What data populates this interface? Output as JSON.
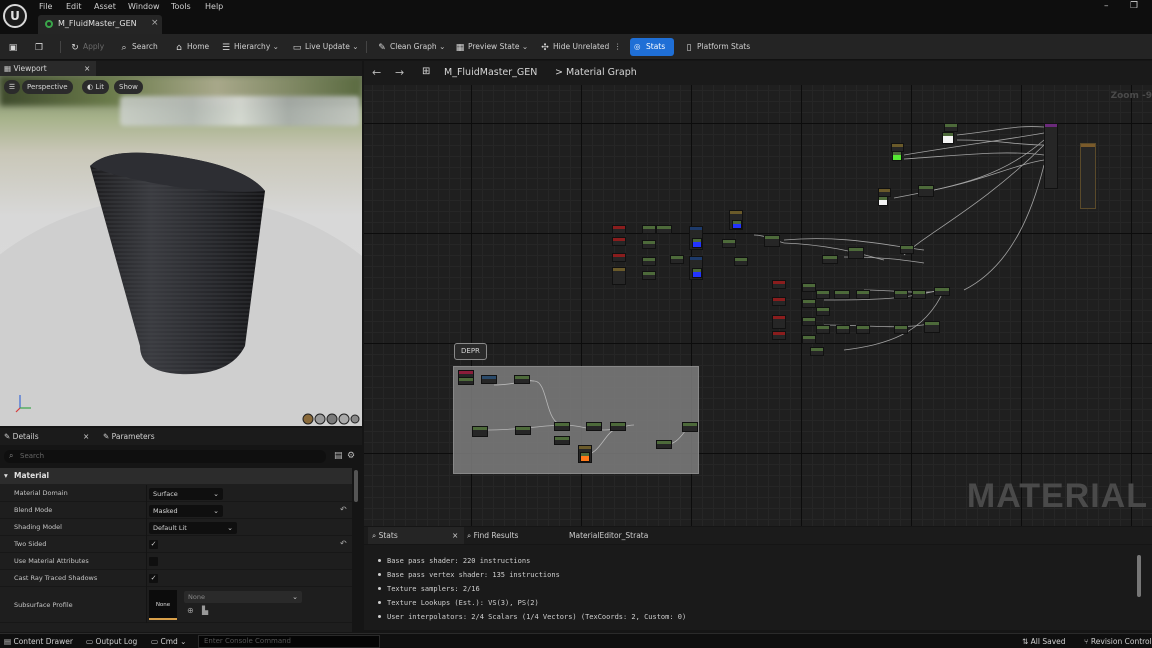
{
  "menu": [
    "File",
    "Edit",
    "Asset",
    "Window",
    "Tools",
    "Help"
  ],
  "logo_text": "U",
  "document_tab": {
    "label": "M_FluidMaster_GEN",
    "close": "×"
  },
  "window_controls": {
    "minimize": "–",
    "restore": "❐"
  },
  "toolbar": {
    "apply": "Apply",
    "search": "Search",
    "home": "Home",
    "hierarchy": "Hierarchy",
    "live_update": "Live Update",
    "clean_graph": "Clean Graph",
    "preview_state": "Preview State",
    "hide_unrelated": "Hide Unrelated",
    "stats": "Stats",
    "platform_stats": "Platform Stats"
  },
  "viewport": {
    "tab_label": "Viewport",
    "close": "×",
    "perspective": "Perspective",
    "lit": "Lit",
    "show": "Show"
  },
  "details": {
    "tab_details": "Details",
    "tab_parameters": "Parameters",
    "close": "×",
    "search_placeholder": "Search",
    "category": "Material",
    "rows": [
      {
        "label": "Material Domain",
        "value": "Surface"
      },
      {
        "label": "Blend Mode",
        "value": "Masked"
      },
      {
        "label": "Shading Model",
        "value": "Default Lit"
      },
      {
        "label": "Two Sided",
        "checked": true
      },
      {
        "label": "Use Material Attributes",
        "checked": false
      },
      {
        "label": "Cast Ray Traced Shadows",
        "checked": true
      },
      {
        "label": "Subsurface Profile",
        "value": "None",
        "thumb": "None"
      }
    ]
  },
  "graph": {
    "breadcrumb_asset": "M_FluidMaster_GEN",
    "breadcrumb_sep": ">",
    "breadcrumb_graph": "Material Graph",
    "zoom": "Zoom -9",
    "watermark": "MATERIAL",
    "comment_title": "DEPR"
  },
  "bottom_tabs": {
    "stats": "Stats",
    "find_results": "Find Results",
    "strata": "MaterialEditor_Strata",
    "close": "×"
  },
  "stats_lines": [
    "Base pass shader: 220 instructions",
    "Base pass vertex shader: 135 instructions",
    "Texture samplers: 2/16",
    "Texture Lookups (Est.): VS(3), PS(2)",
    "User interpolators: 2/4 Scalars (1/4 Vectors) (TexCoords: 2, Custom: 0)"
  ],
  "statusbar": {
    "content_drawer": "Content Drawer",
    "output_log": "Output Log",
    "cmd": "Cmd",
    "console_placeholder": "Enter Console Command",
    "all_saved": "All Saved",
    "revision_control": "Revision Control"
  },
  "colors": {
    "accent": "#1f6fd6",
    "node_header_green": "#4d6a3a",
    "node_header_red": "#8a1d1d",
    "node_header_blue": "#1d3a6a"
  }
}
